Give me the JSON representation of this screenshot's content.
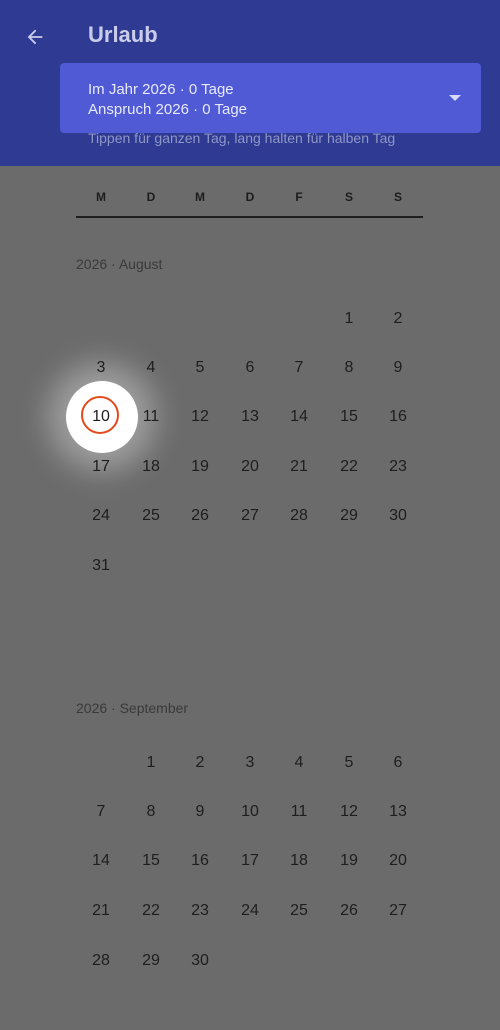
{
  "header": {
    "title": "Urlaub",
    "summary_line1": "Im Jahr 2026 · 0 Tage",
    "summary_line2": "Anspruch 2026 · 0 Tage",
    "hint": "Tippen für ganzen Tag, lang halten für halben Tag"
  },
  "weekdays": [
    "M",
    "D",
    "M",
    "D",
    "F",
    "S",
    "S"
  ],
  "months": [
    {
      "label": "2026 · August"
    },
    {
      "label": "2026 · September"
    }
  ],
  "days": {
    "aug": [
      "1",
      "2",
      "3",
      "4",
      "5",
      "6",
      "7",
      "8",
      "9",
      "10",
      "11",
      "12",
      "13",
      "14",
      "15",
      "16",
      "17",
      "18",
      "19",
      "20",
      "21",
      "22",
      "23",
      "24",
      "25",
      "26",
      "27",
      "28",
      "29",
      "30",
      "31"
    ],
    "sep": [
      "1",
      "2",
      "3",
      "4",
      "5",
      "6",
      "7",
      "8",
      "9",
      "10",
      "11",
      "12",
      "13",
      "14",
      "15",
      "16",
      "17",
      "18",
      "19",
      "20",
      "21",
      "22",
      "23",
      "24",
      "25",
      "26",
      "27",
      "28",
      "29",
      "30"
    ]
  },
  "today": "10",
  "colors": {
    "header_bg": "#2f3a93",
    "summary_bg": "#4f5ad4",
    "today_ring": "#e34a1b",
    "page_bg": "#6b6b6b"
  }
}
